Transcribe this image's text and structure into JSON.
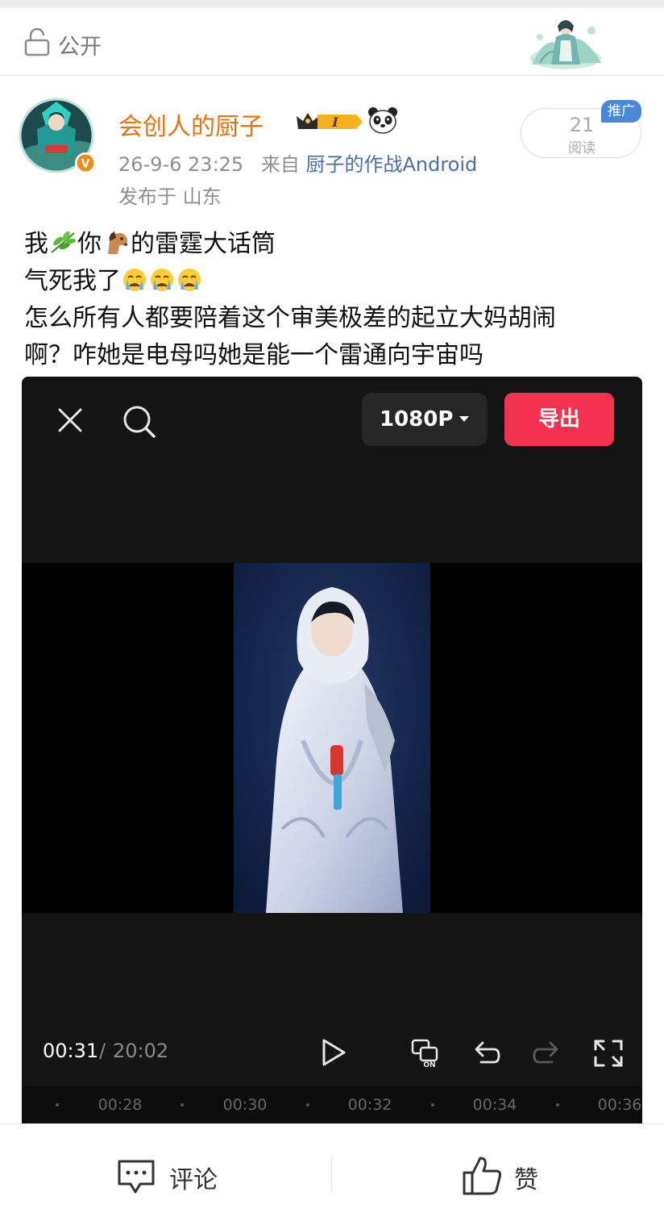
{
  "privacy": {
    "label": "公开",
    "icon": "lock-open-icon"
  },
  "user": {
    "name": "会创人的厨子",
    "level_badge": "I",
    "verified_mark": "V",
    "time": "26-9-6 23:25",
    "source_prefix": "来自",
    "source": "厨子的作战Android",
    "location_prefix": "发布于",
    "location": "山东"
  },
  "read": {
    "count": "21",
    "label": "阅读",
    "promo": "推广"
  },
  "post": {
    "line1_a": "我",
    "line1_b": "你",
    "line1_c": "的雷霆大话筒",
    "line2": "气死我了",
    "line3": "怎么所有人都要陪着这个审美极差的起立大妈胡闹",
    "line4": "啊？咋她是电母吗她是能一个雷通向宇宙吗",
    "emoji": [
      "leaf-emoji",
      "horse-emoji",
      "crying-emoji",
      "crying-emoji",
      "crying-emoji"
    ]
  },
  "video": {
    "quality": "1080P",
    "export": "导出",
    "time_current": "00:31",
    "time_separator": "/",
    "time_total": "20:02",
    "timeline_labels": [
      "00:28",
      "00:30",
      "00:32",
      "00:34",
      "00:36"
    ],
    "controls": [
      "play-icon",
      "caption-on-icon",
      "undo-icon",
      "redo-icon",
      "fullscreen-icon"
    ],
    "toggle_text": "ON"
  },
  "actions": {
    "comment": "评论",
    "like": "赞"
  },
  "colors": {
    "username": "#e8730c",
    "link": "#4b6ea6",
    "export": "#f2324f",
    "promo": "#4a88d6",
    "video_bg": "#141414"
  }
}
